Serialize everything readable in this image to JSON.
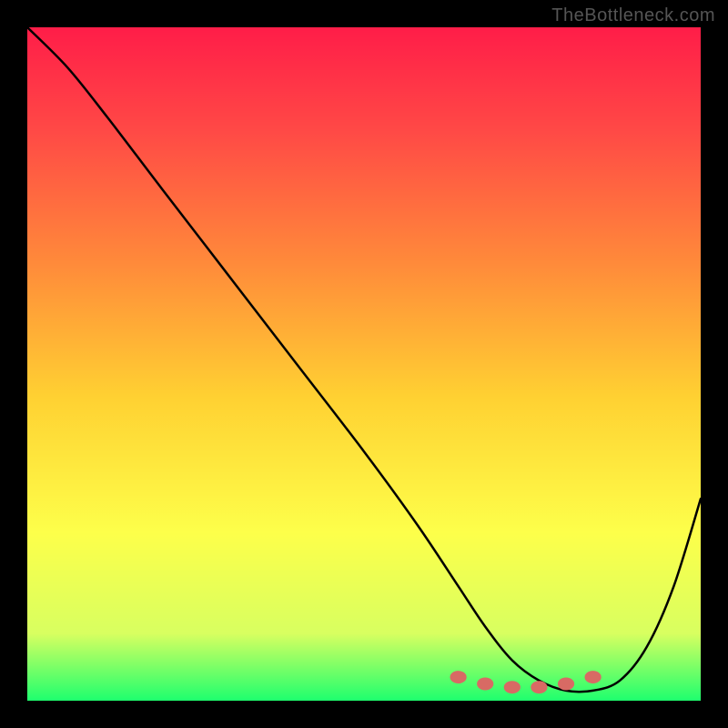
{
  "attribution": "TheBottleneck.com",
  "chart_data": {
    "type": "line",
    "title": "",
    "xlabel": "",
    "ylabel": "",
    "xlim": [
      0,
      100
    ],
    "ylim": [
      0,
      100
    ],
    "background_gradient": {
      "stops": [
        {
          "pct": 0,
          "color": "#ff1d48"
        },
        {
          "pct": 15,
          "color": "#ff4846"
        },
        {
          "pct": 35,
          "color": "#ff8a3a"
        },
        {
          "pct": 55,
          "color": "#ffd132"
        },
        {
          "pct": 75,
          "color": "#fdff4a"
        },
        {
          "pct": 90,
          "color": "#d8ff60"
        },
        {
          "pct": 100,
          "color": "#1eff6e"
        }
      ]
    },
    "curve": {
      "x": [
        0,
        6,
        12,
        20,
        30,
        40,
        50,
        58,
        64,
        68,
        72,
        76,
        80,
        84,
        88,
        92,
        96,
        100
      ],
      "values": [
        100,
        94,
        86.5,
        76,
        63,
        50,
        37,
        26,
        17,
        11,
        6,
        3,
        1.5,
        1.5,
        3,
        8,
        17,
        30
      ]
    },
    "flat_region_markers": {
      "x": [
        64,
        68,
        72,
        76,
        80,
        84
      ],
      "values": [
        3.5,
        2.5,
        2,
        2,
        2.5,
        3.5
      ],
      "color": "#d86a64",
      "radius": 7
    }
  }
}
